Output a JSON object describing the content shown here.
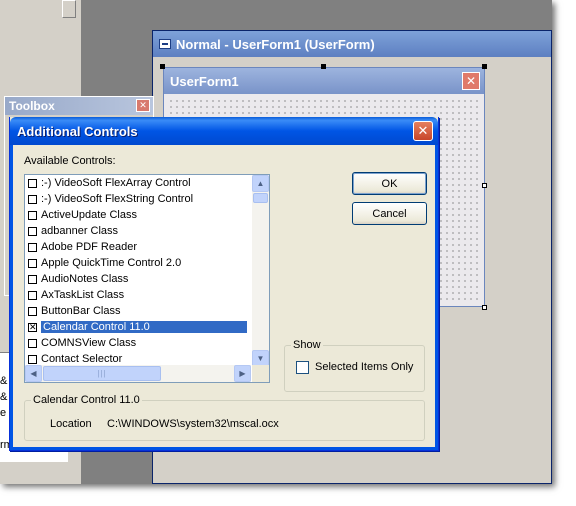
{
  "background_window": {
    "title": "Normal - UserForm1 (UserForm)"
  },
  "userform": {
    "title": "UserForm1",
    "close_glyph": "✕"
  },
  "toolbox": {
    "title": "Toolbox",
    "close_glyph": "✕"
  },
  "left_panel_fragments": [
    "&",
    "&",
    "e",
    "rm"
  ],
  "dialog": {
    "title": "Additional Controls",
    "close_glyph": "✕",
    "available_label": "Available Controls:",
    "controls": [
      {
        "label": ":-) VideoSoft FlexArray Control",
        "checked": false,
        "selected": false
      },
      {
        "label": ":-) VideoSoft FlexString Control",
        "checked": false,
        "selected": false
      },
      {
        "label": "ActiveUpdate Class",
        "checked": false,
        "selected": false
      },
      {
        "label": "adbanner Class",
        "checked": false,
        "selected": false
      },
      {
        "label": "Adobe PDF Reader",
        "checked": false,
        "selected": false
      },
      {
        "label": "Apple QuickTime Control 2.0",
        "checked": false,
        "selected": false
      },
      {
        "label": "AudioNotes Class",
        "checked": false,
        "selected": false
      },
      {
        "label": "AxTaskList Class",
        "checked": false,
        "selected": false
      },
      {
        "label": "ButtonBar Class",
        "checked": false,
        "selected": false
      },
      {
        "label": "Calendar Control 11.0",
        "checked": true,
        "selected": true
      },
      {
        "label": "COMNSView Class",
        "checked": false,
        "selected": false
      },
      {
        "label": "Contact Selector",
        "checked": false,
        "selected": false
      }
    ],
    "ok_label": "OK",
    "cancel_label": "Cancel",
    "show_group_label": "Show",
    "selected_only_label": "Selected Items Only",
    "selected_only_checked": false,
    "info_group_label": "Calendar Control 11.0",
    "location_label": "Location",
    "location_value": "C:\\WINDOWS\\system32\\mscal.ocx"
  },
  "icons": {
    "scroll_up": "▲",
    "scroll_down": "▼",
    "scroll_left": "◀",
    "scroll_right": "▶",
    "thumb_grip": "|||",
    "checked_mark": "✕"
  },
  "colors": {
    "xp_titlebar": "#0055e5",
    "selection": "#316ac5",
    "dialog_face": "#ece9d8",
    "desktop_gray": "#808080"
  }
}
